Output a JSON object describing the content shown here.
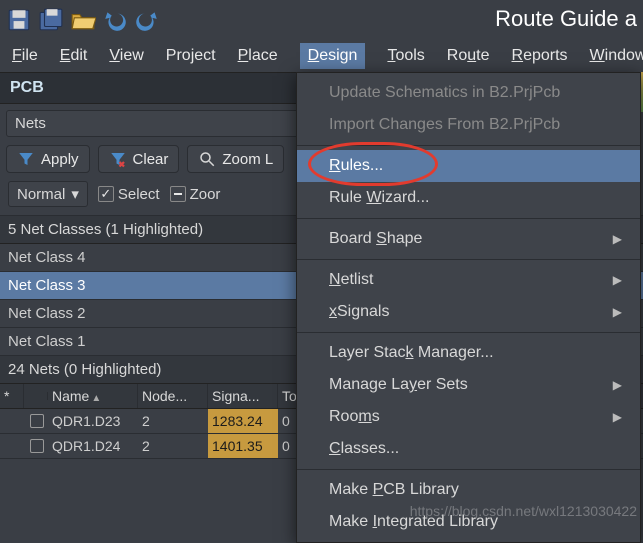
{
  "app": {
    "title": "Route Guide a"
  },
  "menu": {
    "items": [
      "File",
      "Edit",
      "View",
      "Project",
      "Place",
      "Design",
      "Tools",
      "Route",
      "Reports",
      "Window"
    ],
    "ul": [
      "F",
      "E",
      "V",
      "P",
      "P",
      "D",
      "T",
      "R",
      "R",
      "W"
    ],
    "active_index": 5
  },
  "panel": {
    "title": "PCB"
  },
  "subpanel": {
    "label": "Nets"
  },
  "buttons": {
    "apply": "Apply",
    "clear": "Clear",
    "zoom": "Zoom L"
  },
  "row2": {
    "mode": "Normal",
    "select": "Select",
    "zoom": "Zoor"
  },
  "classes": {
    "header": "5 Net Classes (1 Highlighted)",
    "rows": [
      "Net Class 4",
      "Net Class 3",
      "Net Class 2",
      "Net Class 1"
    ],
    "sel_index": 1
  },
  "nets": {
    "header": "24 Nets (0 Highlighted)",
    "cols": [
      "*",
      "",
      "Name",
      "Node...",
      "Signa...",
      "Tota"
    ],
    "rows": [
      {
        "name": "QDR1.D23",
        "node": "2",
        "sig": "1283.24",
        "tot": "0"
      },
      {
        "name": "QDR1.D24",
        "node": "2",
        "sig": "1401.35",
        "tot": "0"
      }
    ]
  },
  "designMenu": {
    "update": "Update Schematics in B2.PrjPcb",
    "import": "Import Changes From B2.PrjPcb",
    "rules": "Rules...",
    "wizard": "Rule Wizard...",
    "shape": "Board Shape",
    "netlist": "Netlist",
    "xsignals": "xSignals",
    "stack": "Layer Stack Manager...",
    "layersets": "Manage Layer Sets",
    "rooms": "Rooms",
    "classes": "Classes...",
    "makepcb": "Make PCB Library",
    "makeint": "Make Integrated Library"
  },
  "watermark": "https://blog.csdn.net/wxl1213030422"
}
